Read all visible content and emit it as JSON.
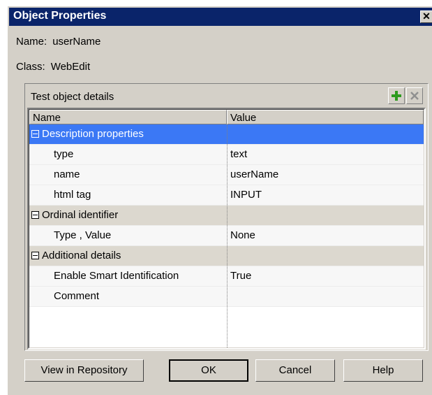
{
  "window": {
    "title": "Object Properties",
    "close_symbol": "✕"
  },
  "info": {
    "name_label": "Name:",
    "name_value": "userName",
    "class_label": "Class:",
    "class_value": "WebEdit"
  },
  "details": {
    "title": "Test object details",
    "add_symbol": "+",
    "remove_symbol": "✕",
    "columns": [
      "Name",
      "Value"
    ],
    "sections": [
      {
        "label": "Description properties",
        "rows": [
          {
            "name": "type",
            "value": "text"
          },
          {
            "name": "name",
            "value": "userName"
          },
          {
            "name": "html tag",
            "value": "INPUT"
          }
        ]
      },
      {
        "label": "Ordinal identifier",
        "rows": [
          {
            "name": "Type , Value",
            "value": "None"
          }
        ]
      },
      {
        "label": "Additional details",
        "rows": [
          {
            "name": "Enable Smart Identification",
            "value": "True"
          },
          {
            "name": "Comment",
            "value": ""
          }
        ]
      }
    ]
  },
  "buttons": {
    "repository": "View in Repository",
    "ok": "OK",
    "cancel": "Cancel",
    "help": "Help"
  },
  "colors": {
    "title_bg": "#0a246a",
    "selection": "#3b78f5",
    "add_icon": "#2e9a1f"
  }
}
